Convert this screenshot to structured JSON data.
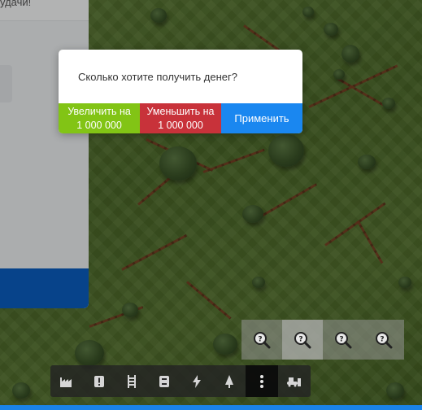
{
  "side_panel": {
    "top_text": "удачи!"
  },
  "dialog": {
    "question": "Сколько хотите получить денег?",
    "increase_line1": "Увеличить на",
    "increase_line2": "1 000 000",
    "decrease_line1": "Уменьшить на",
    "decrease_line2": "1 000 000",
    "apply_label": "Применить"
  },
  "colors": {
    "increase": "#82c415",
    "decrease": "#c8323a",
    "apply": "#1a87f0",
    "side_blue": "#0a5dbf",
    "bottom_bar": "#1a83e8"
  },
  "zoom_buttons": [
    "zoom-icon",
    "zoom-icon",
    "zoom-icon",
    "zoom-icon"
  ],
  "toolbar_icons": [
    "factory-icon",
    "alert-icon",
    "railway-icon",
    "storage-icon",
    "lightning-icon",
    "tree-icon",
    "more-icon",
    "bulldozer-icon"
  ]
}
